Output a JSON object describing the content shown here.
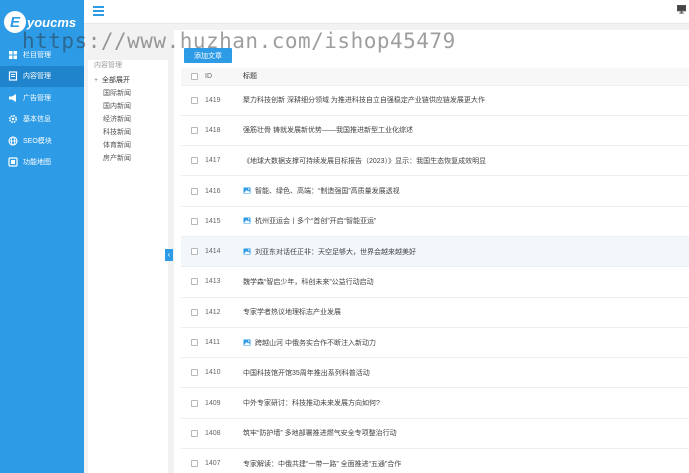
{
  "brand": {
    "badge": "E",
    "name": "youcms"
  },
  "watermark": "https://www.huzhan.com/ishop45479",
  "sidebar": {
    "items": [
      {
        "label": "栏目管理",
        "icon": "grid-icon"
      },
      {
        "label": "内容管理",
        "icon": "document-icon",
        "active": true
      },
      {
        "label": "广告管理",
        "icon": "megaphone-icon"
      },
      {
        "label": "基本信息",
        "icon": "gear-icon"
      },
      {
        "label": "SEO模块",
        "icon": "globe-icon"
      },
      {
        "label": "功能地图",
        "icon": "map-icon"
      }
    ]
  },
  "tree": {
    "header": "内容管理",
    "root": {
      "expander": "+",
      "label": "全部展开"
    },
    "items": [
      "国际新闻",
      "国内新闻",
      "经济新闻",
      "科技新闻",
      "体育新闻",
      "房产新闻"
    ]
  },
  "toolbar": {
    "add_label": "添加文章"
  },
  "table": {
    "headers": {
      "id": "ID",
      "title": "标题"
    },
    "rows": [
      {
        "id": "1419",
        "title": "聚力科技创新 深耕细分领域 为推进科技自立自强稳定产业链供应链发展更大作",
        "image": false
      },
      {
        "id": "1418",
        "title": "强筋壮骨 铸就发展新优势——我国推进新型工业化综述",
        "image": false
      },
      {
        "id": "1417",
        "title": "《地球大数据支撑可持续发展目标报告（2023）》显示：我国生态恢复成效明显",
        "image": false
      },
      {
        "id": "1416",
        "title": "智能、绿色、高端：“制造强国”高质量发展透视",
        "image": true
      },
      {
        "id": "1415",
        "title": "杭州亚运会丨多个“首创”开启“智能亚运”",
        "image": true
      },
      {
        "id": "1414",
        "title": "刘亚东对话任正非：天空足够大，世界会越来越美好",
        "image": true,
        "highlight": true
      },
      {
        "id": "1413",
        "title": "魏学森“智启少年，科创未来”公益行动启动",
        "image": false
      },
      {
        "id": "1412",
        "title": "专家学者热议地理标志产业发展",
        "image": false
      },
      {
        "id": "1411",
        "title": "跨越山河 中俄务实合作不断注入新动力",
        "image": true
      },
      {
        "id": "1410",
        "title": "中国科技馆开馆35周年推出系列科普活动",
        "image": false
      },
      {
        "id": "1409",
        "title": "中外专家研讨：科技推动未来发展方向如何?",
        "image": false
      },
      {
        "id": "1408",
        "title": "筑牢“防护墙” 多地部署推进燃气安全专项整治行动",
        "image": false
      },
      {
        "id": "1407",
        "title": "专家解读：中俄共建“一带一路” 全面推进“五通”合作",
        "image": false
      }
    ]
  },
  "colors": {
    "accent": "#2e9be6",
    "active_menu": "#1f84cc"
  }
}
